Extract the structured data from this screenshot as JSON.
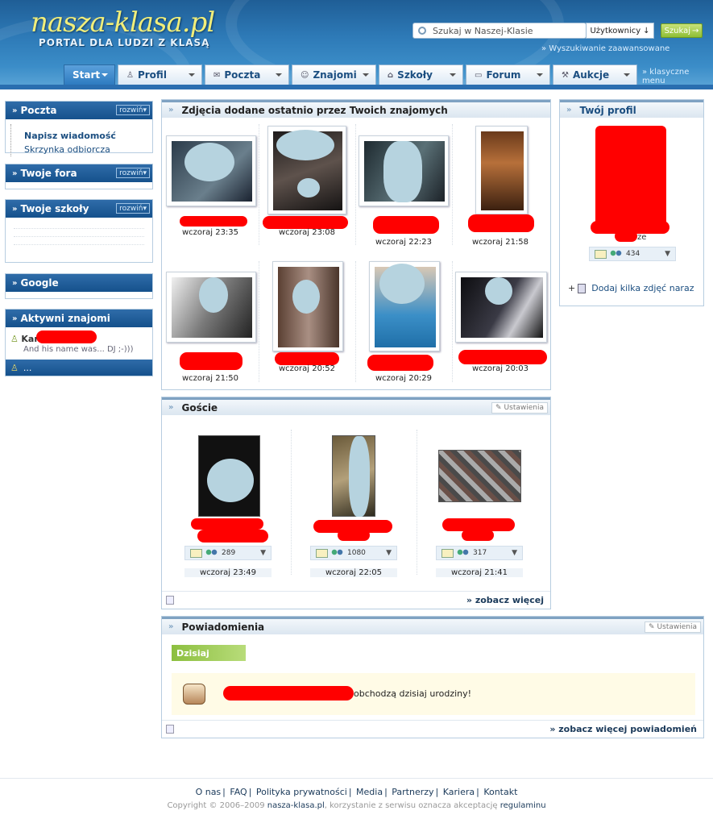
{
  "header": {
    "logo": "nasza-klasa.pl",
    "tagline": "PORTAL DLA LUDZI Z KLASĄ",
    "search_placeholder": "Szukaj w Naszej-Klasie",
    "search_scope": "Użytkownicy",
    "search_button": "Szukaj",
    "advanced_search": "» Wyszukiwanie zaawansowane",
    "classic_menu": "» klasyczne menu"
  },
  "tabs": [
    {
      "label": "Start",
      "icon": ""
    },
    {
      "label": "Profil",
      "icon": "person-icon"
    },
    {
      "label": "Poczta",
      "icon": "envelope-icon"
    },
    {
      "label": "Znajomi",
      "icon": "friends-icon"
    },
    {
      "label": "Szkoły",
      "icon": "school-icon"
    },
    {
      "label": "Forum",
      "icon": "forum-icon"
    },
    {
      "label": "Aukcje",
      "icon": "auction-icon"
    }
  ],
  "sidebar": {
    "poczta": {
      "title": "Poczta",
      "expand": "rozwiń",
      "items": [
        "Napisz wiadomość",
        "Skrzynka odbiorcza"
      ]
    },
    "fora": {
      "title": "Twoje fora",
      "expand": "rozwiń"
    },
    "szkoly": {
      "title": "Twoje szkoły",
      "expand": "rozwiń"
    },
    "google": {
      "title": "Google"
    },
    "aktywni": {
      "title": "Aktywni znajomi",
      "friend_name": "Kar",
      "friend_status": "And his name was... DJ ;-)))",
      "more": "..."
    }
  },
  "photos": {
    "title": "Zdjęcia dodane ostatnio przez Twoich znajomych",
    "times": [
      "wczoraj 23:35",
      "wczoraj 23:08",
      "wczoraj 22:23",
      "wczoraj 21:58",
      "wczoraj 21:50",
      "wczoraj 20:52",
      "wczoraj 20:29",
      "wczoraj 20:03"
    ]
  },
  "guests": {
    "title": "Goście",
    "settings": "Ustawienia",
    "items": [
      {
        "count": "289",
        "time": "wczoraj 23:49"
      },
      {
        "count": "1080",
        "time": "wczoraj 22:05"
      },
      {
        "count": "317",
        "time": "wczoraj 21:41"
      }
    ],
    "see_more": "zobacz więcej"
  },
  "notifications": {
    "title": "Powiadomienia",
    "settings": "Ustawienia",
    "today": "Dzisiaj",
    "birthday_text": "obchodzą dzisiaj urodziny!",
    "see_more": "zobacz więcej powiadomień"
  },
  "profile": {
    "title": "Twój profil",
    "name_suffix": "ze",
    "count": "434",
    "add_photos": "Dodaj kilka zdjęć naraz"
  },
  "footer": {
    "links": [
      "O nas",
      "FAQ",
      "Polityka prywatności",
      "Media",
      "Partnerzy",
      "Kariera",
      "Kontakt"
    ],
    "copyright": "Copyright © 2006–2009",
    "site": "nasza-klasa.pl",
    "tos_text": ", korzystanie z serwisu oznacza akceptację",
    "tos_link": "regulaminu"
  }
}
